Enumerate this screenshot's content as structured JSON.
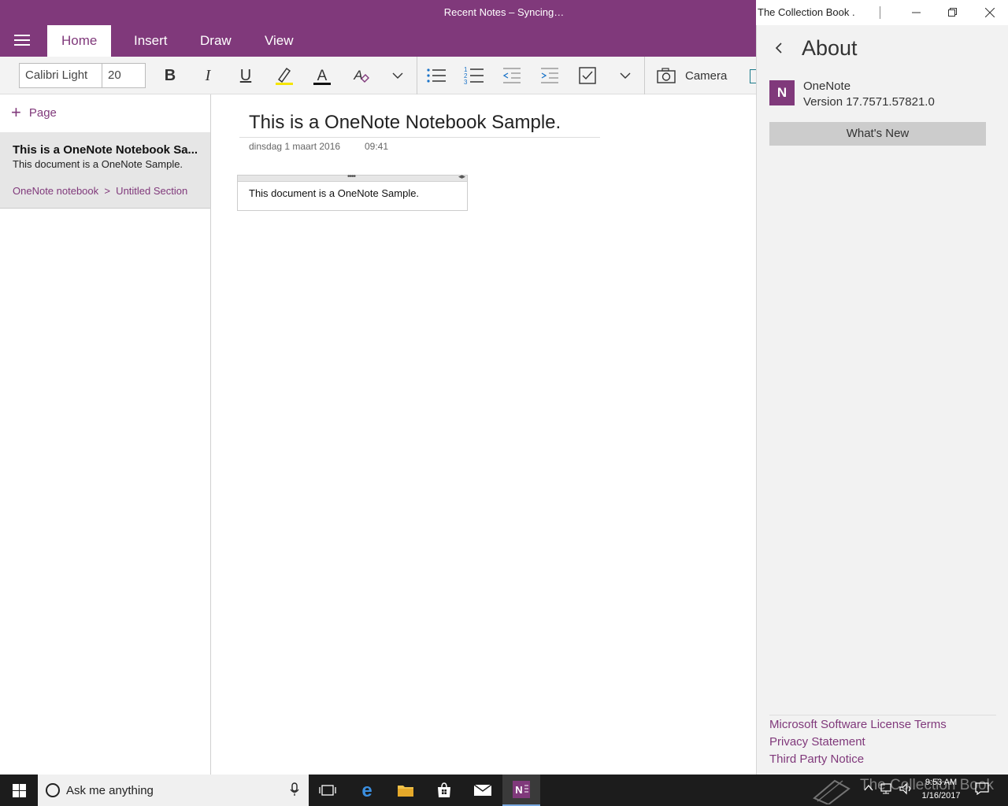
{
  "window": {
    "title": "Recent Notes – Syncing…",
    "notebook_name": "The Collection Book ."
  },
  "tabs": [
    {
      "label": "Home",
      "active": true
    },
    {
      "label": "Insert",
      "active": false
    },
    {
      "label": "Draw",
      "active": false
    },
    {
      "label": "View",
      "active": false
    }
  ],
  "toolbar": {
    "font_name": "Calibri Light",
    "font_size": "20",
    "camera_label": "Camera"
  },
  "pagelist": {
    "add_page_label": "Page",
    "page": {
      "title": "This is a OneNote Notebook Sa...",
      "snippet": "This document is a OneNote Sample.",
      "path": "OneNote notebook  >  Untitled Section"
    }
  },
  "note": {
    "title": "This is a OneNote Notebook Sample.",
    "date": "dinsdag 1 maart 2016",
    "time": "09:41",
    "body": "This document is a OneNote Sample."
  },
  "about": {
    "title": "About",
    "app_name": "OneNote",
    "version": "Version 17.7571.57821.0",
    "whats_new": "What's New",
    "links": [
      "Microsoft Software License Terms",
      "Privacy Statement",
      "Third Party Notice"
    ]
  },
  "taskbar": {
    "search_placeholder": "Ask me anything",
    "time": "9:53 AM",
    "date": "1/16/2017",
    "watermark": "The Collection Book"
  },
  "colors": {
    "accent": "#80397B",
    "taskbar": "#1c1c1c"
  }
}
